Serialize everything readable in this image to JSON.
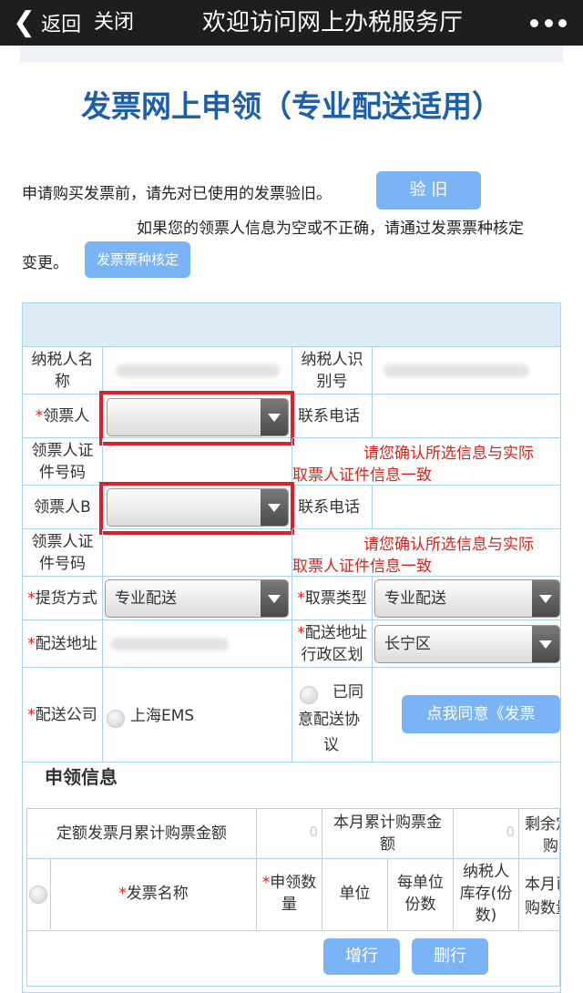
{
  "topbar": {
    "back_label": "返回",
    "close_label": "关闭",
    "title": "欢迎访问网上办税服务厅"
  },
  "heading": "发票网上申领（专业配送适用）",
  "notice": {
    "line1": "申请购买发票前，请先对已使用的发票验旧。",
    "verify_button": "验 旧",
    "line2": "如果您的领票人信息为空或不正确，请通过发票票种核定",
    "line3": "变更。",
    "verify_type_button": "发票票种核定"
  },
  "form": {
    "taxpayer_name_label_1": "纳税人名",
    "taxpayer_name_label_2": "称",
    "taxpayer_id_label_1": "纳税人识",
    "taxpayer_id_label_2": "别号",
    "required_mark": "*",
    "collector_label": "领票人",
    "phone_label": "联系电话",
    "id_no_label_1": "领票人证",
    "id_no_label_2": "件号码",
    "confirm_note_1": "请您确认所选信息与实际",
    "confirm_note_2": "取票人证件信息一致",
    "collector_b_label": "领票人B",
    "delivery_method_label": "提货方式",
    "delivery_method_value": "专业配送",
    "pickup_type_label": "取票类型",
    "pickup_type_value": "专业配送",
    "address_label": "配送地址",
    "district_label_1": "配送地址",
    "district_label_2": "行政区划",
    "district_value": "长宁区",
    "company_label": "配送公司",
    "company_option": "上海EMS",
    "agree_text_1": "已同",
    "agree_text_2": "意配送协",
    "agree_text_3": "议",
    "agree_button": "点我同意《发票"
  },
  "apply": {
    "section_title": "申领信息",
    "fixed_amount_label": "定额发票月累计购票金额",
    "fixed_amount_value": "0",
    "month_amount_label_1": "本月累计购票金",
    "month_amount_label_2": "额",
    "month_amount_value": "0",
    "remaining_label_1": "剩余定",
    "remaining_label_2": "购",
    "col_name": "发票名称",
    "col_qty_1": "申领数",
    "col_qty_2": "量",
    "col_unit": "单位",
    "col_per_unit_1": "每单位",
    "col_per_unit_2": "份数",
    "col_stock_1": "纳税人",
    "col_stock_2": "库存(份",
    "col_stock_3": "数)",
    "col_month_1": "本月已",
    "col_month_2": "购数量",
    "add_row_button": "增行",
    "del_row_button": "删行"
  },
  "colors": {
    "accent": "#7ab4f5",
    "heading": "#1e5fa8",
    "required": "#d9261c",
    "highlight_box": "#e01e2a",
    "table_border": "#a9d4ec"
  }
}
